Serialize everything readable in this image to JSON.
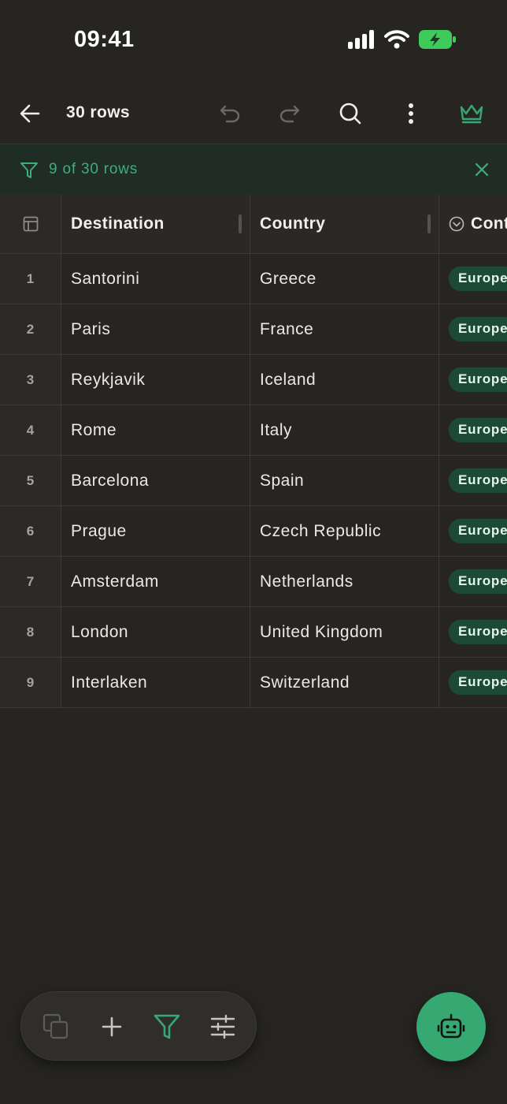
{
  "status_bar": {
    "time": "09:41"
  },
  "top_bar": {
    "title": "30 rows",
    "icons": [
      "back-arrow-icon",
      "undo-icon",
      "redo-icon",
      "search-icon",
      "more-vertical-icon",
      "crown-icon"
    ]
  },
  "filter_banner": {
    "text": "9 of 30 rows"
  },
  "table": {
    "columns": [
      "Destination",
      "Country",
      "Continent"
    ],
    "header_visible": {
      "continent": "Cont"
    },
    "rows": [
      {
        "index": "1",
        "destination": "Santorini",
        "country": "Greece",
        "continent": "Europe"
      },
      {
        "index": "2",
        "destination": "Paris",
        "country": "France",
        "continent": "Europe"
      },
      {
        "index": "3",
        "destination": "Reykjavik",
        "country": "Iceland",
        "continent": "Europe"
      },
      {
        "index": "4",
        "destination": "Rome",
        "country": "Italy",
        "continent": "Europe"
      },
      {
        "index": "5",
        "destination": "Barcelona",
        "country": "Spain",
        "continent": "Europe"
      },
      {
        "index": "6",
        "destination": "Prague",
        "country": "Czech Republic",
        "continent": "Europe"
      },
      {
        "index": "7",
        "destination": "Amsterdam",
        "country": "Netherlands",
        "continent": "Europe"
      },
      {
        "index": "8",
        "destination": "London",
        "country": "United Kingdom",
        "continent": "Europe"
      },
      {
        "index": "9",
        "destination": "Interlaken",
        "country": "Switzerland",
        "continent": "Europe"
      }
    ]
  },
  "bottom_toolbar": {
    "icons": [
      "copy-icon",
      "plus-icon",
      "filter-icon",
      "sliders-icon"
    ]
  },
  "fab": {
    "icon": "robot-icon"
  },
  "colors": {
    "accent": "#36a872",
    "filter_text": "#3fae78",
    "pill_bg": "#1d4a38",
    "background": "#262522"
  }
}
